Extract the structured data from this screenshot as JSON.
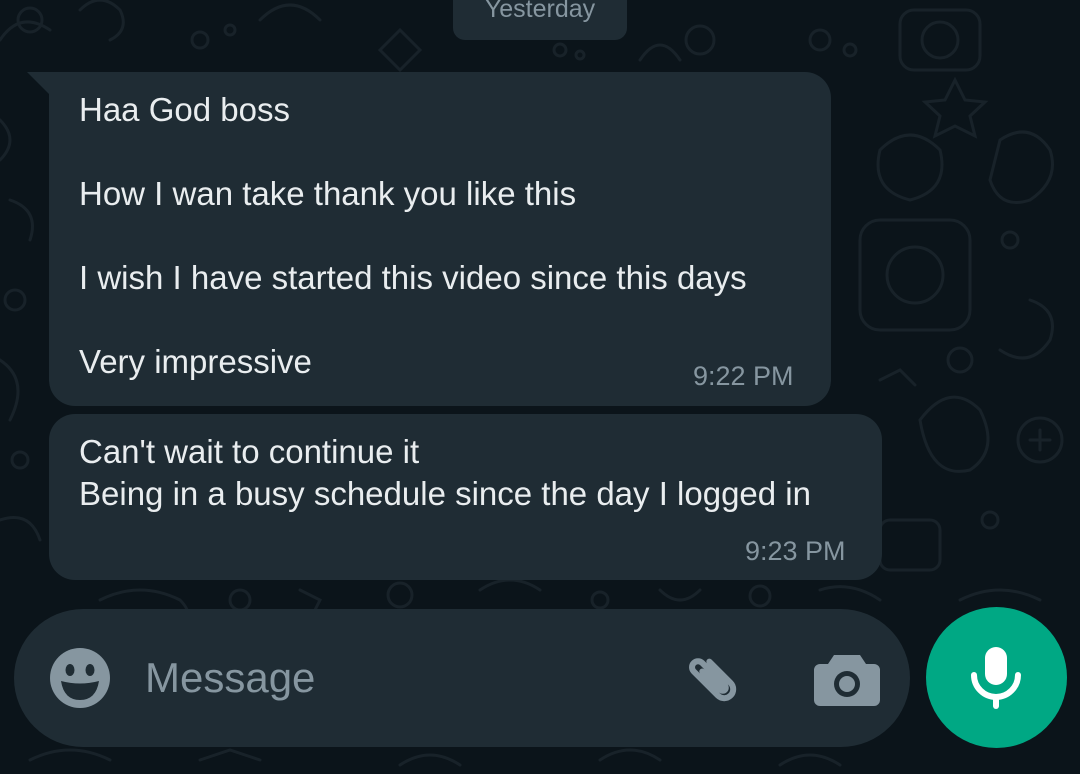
{
  "chat": {
    "date_separator": "Yesterday",
    "messages": [
      {
        "lines": [
          "Haa God boss",
          "How I wan take thank you like this",
          "I wish I have started this video since this days",
          "Very impressive"
        ],
        "time": "9:22 PM"
      },
      {
        "lines": [
          "Can't wait to continue it",
          "Being in a busy schedule since the day I logged in"
        ],
        "time": "9:23 PM"
      }
    ]
  },
  "composer": {
    "placeholder": "Message",
    "emoji_icon": "emoji-icon",
    "attach_icon": "paperclip-icon",
    "camera_icon": "camera-icon",
    "mic_icon": "microphone-icon"
  },
  "colors": {
    "background": "#0b141a",
    "bubble": "#1f2c34",
    "text": "#e9edef",
    "muted": "#8696a0",
    "accent": "#00a884"
  }
}
